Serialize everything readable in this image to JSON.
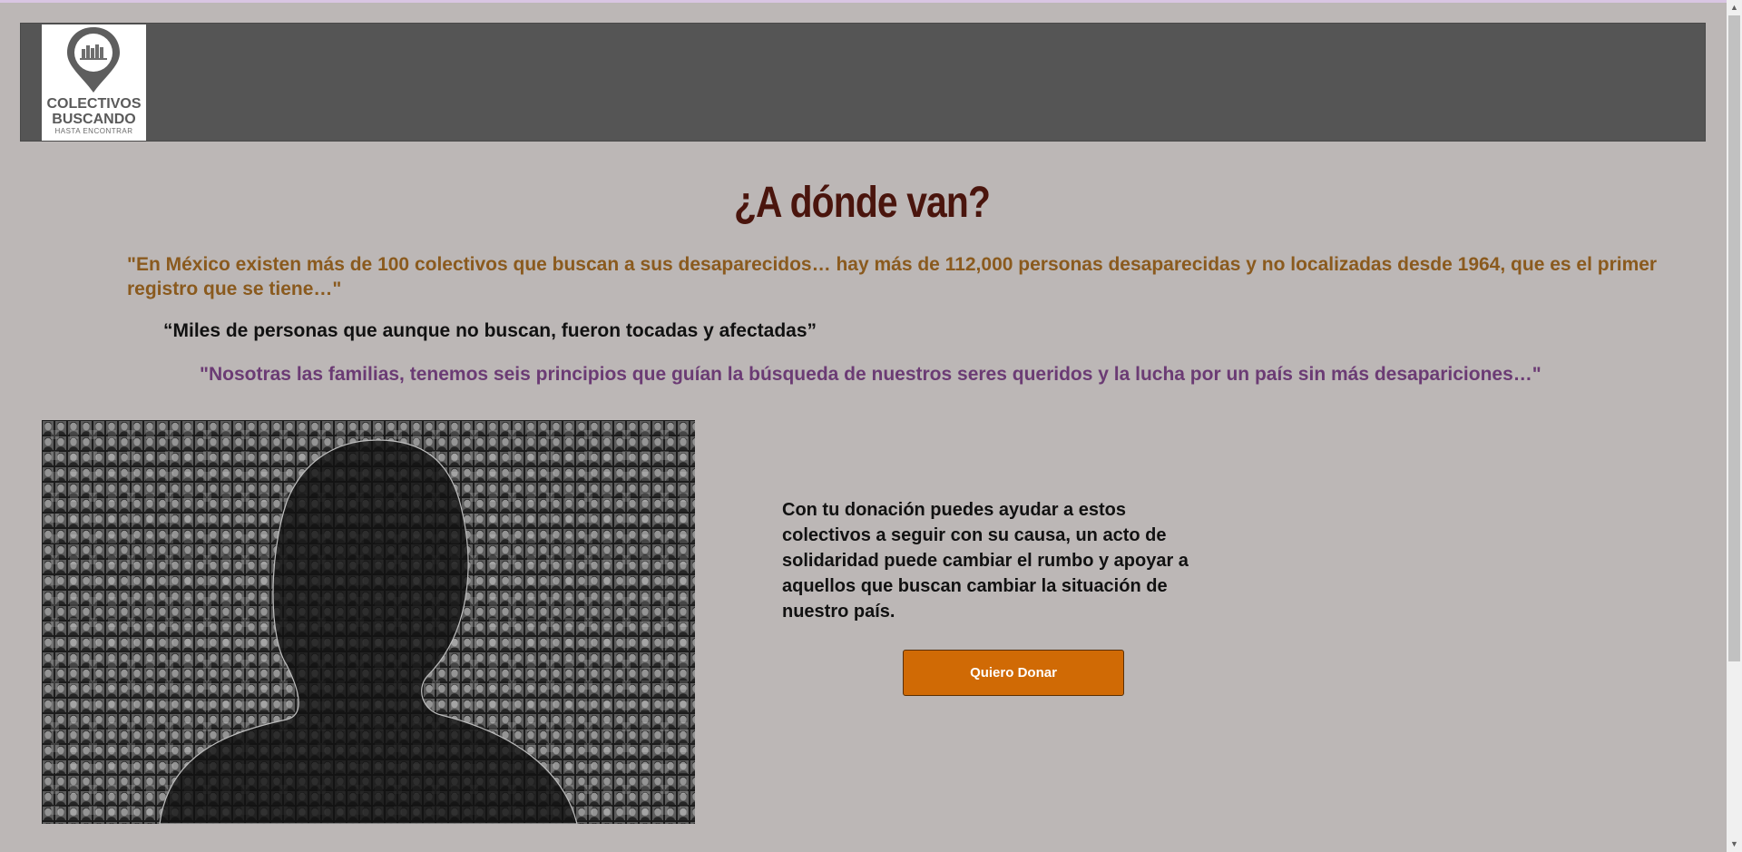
{
  "header": {
    "logo": {
      "line1": "COLECTIVOS",
      "line2": "BUSCANDO",
      "tagline": "HASTA ENCONTRAR"
    }
  },
  "main": {
    "title": "¿A dónde van?",
    "quote1": "\"En México existen más de 100 colectivos que buscan a sus desaparecidos… hay más de 112,000 personas desaparecidas y no localizadas desde 1964, que es el primer registro que se tiene…\"",
    "quote2": "“Miles de personas que aunque no buscan, fueron tocadas y afectadas”",
    "quote3": "\"Nosotras las familias, tenemos seis principios que guían la búsqueda de nuestros seres queridos y la lucha por un país sin más desapariciones…\"",
    "donation_text": "Con tu donación puedes ayudar a estos colectivos a seguir con su causa, un acto de solidaridad puede cambiar el rumbo y apoyar a aquellos que buscan cambiar la situación de nuestro país.",
    "donate_button": "Quiero Donar"
  },
  "colors": {
    "background": "#bcb7b6",
    "header": "#555555",
    "title": "#4a150d",
    "quote1": "#8a5a1e",
    "quote3": "#6b3b74",
    "button": "#d06a05"
  },
  "icons": [
    "map-pin-logo-icon",
    "scroll-up-arrow-icon",
    "scroll-down-arrow-icon"
  ]
}
